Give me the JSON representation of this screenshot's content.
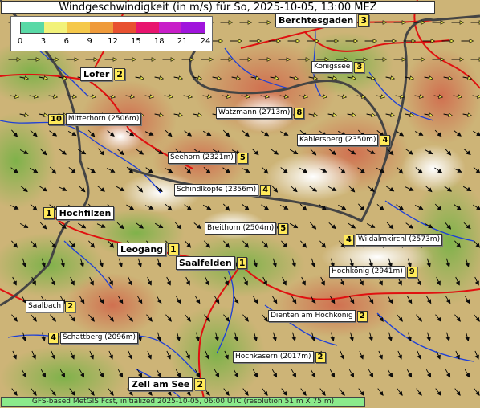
{
  "title": "Windgeschwindigkeit (in m/s) für So, 2025-10-05, 13:00 MEZ",
  "legend": {
    "unit": "m/s",
    "ticks": [
      "0",
      "3",
      "6",
      "9",
      "12",
      "15",
      "18",
      "21",
      "24"
    ],
    "colors": [
      "#59d9a6",
      "#f2f27a",
      "#f5c84a",
      "#ef9a3a",
      "#e85030",
      "#e8146e",
      "#c81ec8",
      "#a014dc"
    ]
  },
  "locations": [
    {
      "id": "berchtesgaden",
      "name": "Berchtesgaden",
      "value": "3",
      "big": true
    },
    {
      "id": "lofer",
      "name": "Lofer",
      "value": "2",
      "big": true
    },
    {
      "id": "koenigssee",
      "name": "Königssee",
      "value": "3",
      "big": false
    },
    {
      "id": "mitterhorn",
      "name": "Mitterhorn (2506m)",
      "value": "10",
      "big": false
    },
    {
      "id": "watzmann",
      "name": "Watzmann (2713m)",
      "value": "8",
      "big": false
    },
    {
      "id": "kahlersberg",
      "name": "Kahlersberg (2350m)",
      "value": "4",
      "big": false
    },
    {
      "id": "seehorn",
      "name": "Seehorn (2321m)",
      "value": "5",
      "big": false
    },
    {
      "id": "schindlkoepfe",
      "name": "Schindlköpfe (2356m)",
      "value": "4",
      "big": false
    },
    {
      "id": "hochfilzen",
      "name": "Hochfilzen",
      "value": "1",
      "big": true
    },
    {
      "id": "breithorn",
      "name": "Breithorn (2504m)",
      "value": "5",
      "big": false
    },
    {
      "id": "wildalmkirchl",
      "name": "Wildalmkirchl (2573m)",
      "value": "4",
      "big": false
    },
    {
      "id": "leogang",
      "name": "Leogang",
      "value": "1",
      "big": true
    },
    {
      "id": "saalfelden",
      "name": "Saalfelden",
      "value": "1",
      "big": true
    },
    {
      "id": "hochkoenig",
      "name": "Hochkönig (2941m)",
      "value": "9",
      "big": false
    },
    {
      "id": "saalbach",
      "name": "Saalbach",
      "value": "2",
      "big": false
    },
    {
      "id": "dienten",
      "name": "Dienten am Hochkönig",
      "value": "2",
      "big": false
    },
    {
      "id": "schattberg",
      "name": "Schattberg (2096m)",
      "value": "4",
      "big": false
    },
    {
      "id": "hochkasern",
      "name": "Hochkasern (2017m)",
      "value": "2",
      "big": false
    },
    {
      "id": "zellamsee",
      "name": "Zell am See",
      "value": "2",
      "big": true
    }
  ],
  "footer": "GFS-based MetGIS Fcst, initialized 2025-10-05, 06:00 UTC  (resolution 51 m X 75 m)"
}
